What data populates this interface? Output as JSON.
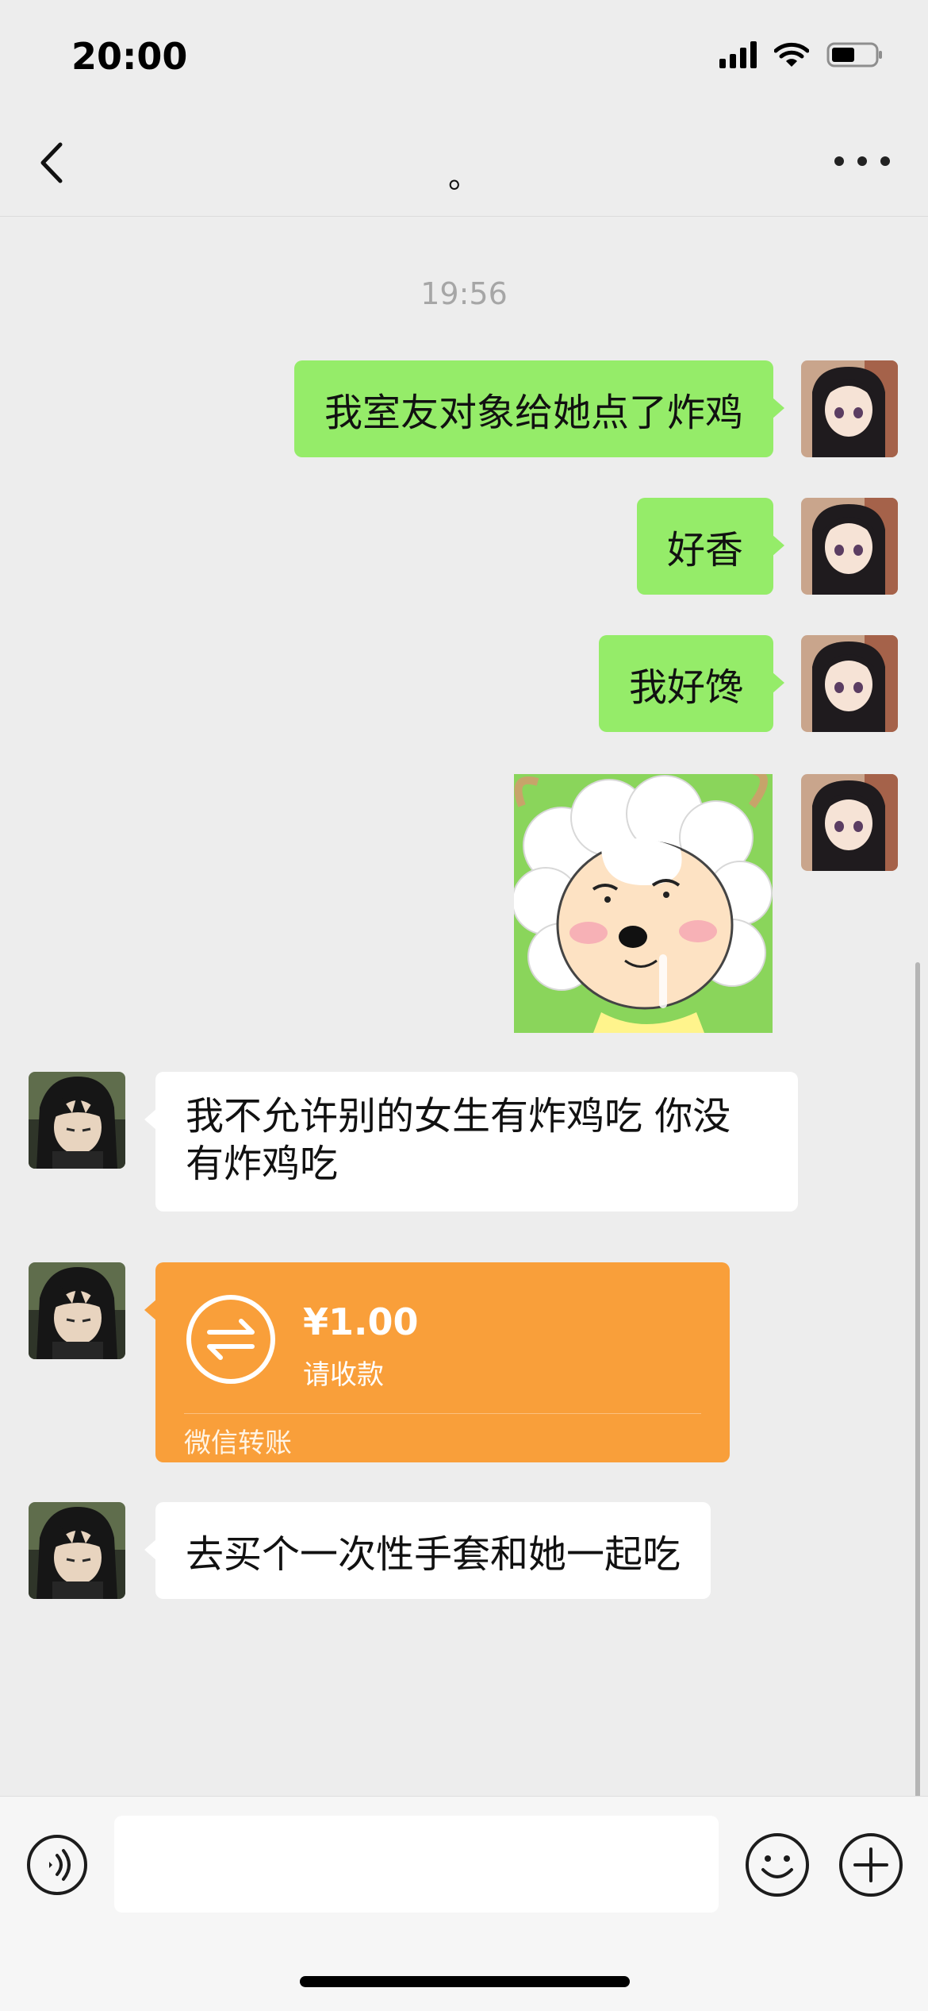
{
  "status_bar": {
    "time": "20:00"
  },
  "header": {
    "title": "。"
  },
  "chat": {
    "timestamp": "19:56",
    "messages": [
      {
        "sender": "me",
        "type": "text",
        "text": "我室友对象给她点了炸鸡"
      },
      {
        "sender": "me",
        "type": "text",
        "text": "好香"
      },
      {
        "sender": "me",
        "type": "text",
        "text": "我好馋"
      },
      {
        "sender": "me",
        "type": "sticker"
      },
      {
        "sender": "them",
        "type": "text",
        "text": "我不允许别的女生有炸鸡吃 你没有炸鸡吃"
      },
      {
        "sender": "them",
        "type": "transfer",
        "amount": "¥1.00",
        "note": "请收款",
        "label": "微信转账"
      },
      {
        "sender": "them",
        "type": "text",
        "text": "去买个一次性手套和她一起吃"
      }
    ]
  },
  "input_bar": {
    "value": ""
  },
  "colors": {
    "my_bubble": "#95ec69",
    "their_bubble": "#ffffff",
    "transfer": "#f99f3a",
    "background": "#ededed"
  }
}
